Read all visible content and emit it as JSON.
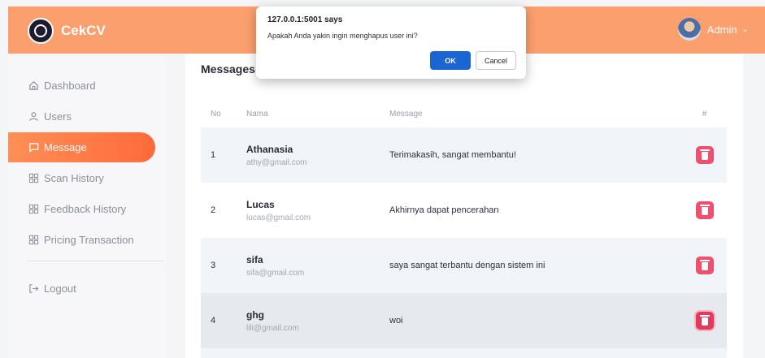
{
  "header": {
    "brand": "CekCV",
    "user_name": "Admin",
    "accent_color": "#fb9f6e"
  },
  "sidebar": {
    "items": [
      {
        "label": "Dashboard",
        "icon": "home-icon"
      },
      {
        "label": "Users",
        "icon": "user-icon"
      },
      {
        "label": "Message",
        "icon": "message-icon",
        "active": true
      },
      {
        "label": "Scan History",
        "icon": "grid-icon"
      },
      {
        "label": "Feedback History",
        "icon": "grid-icon"
      },
      {
        "label": "Pricing Transaction",
        "icon": "grid-icon"
      }
    ],
    "logout": "Logout"
  },
  "main": {
    "title": "Messages",
    "columns": [
      "No",
      "Nama",
      "Message",
      "#"
    ],
    "rows": [
      {
        "no": "1",
        "name": "Athanasia",
        "email": "athy@gmail.com",
        "message": "Terimakasih, sangat membantu!"
      },
      {
        "no": "2",
        "name": "Lucas",
        "email": "lucas@gmail.com",
        "message": "Akhirnya dapat pencerahan"
      },
      {
        "no": "3",
        "name": "sifa",
        "email": "sifa@gmail.com",
        "message": "saya sangat terbantu dengan sistem ini"
      },
      {
        "no": "4",
        "name": "ghg",
        "email": "lili@gmail.com",
        "message": "woi"
      }
    ]
  },
  "dialog": {
    "title": "127.0.0.1:5001 says",
    "message": "Apakah Anda yakin ingin menghapus user ini?",
    "ok_label": "OK",
    "cancel_label": "Cancel"
  }
}
